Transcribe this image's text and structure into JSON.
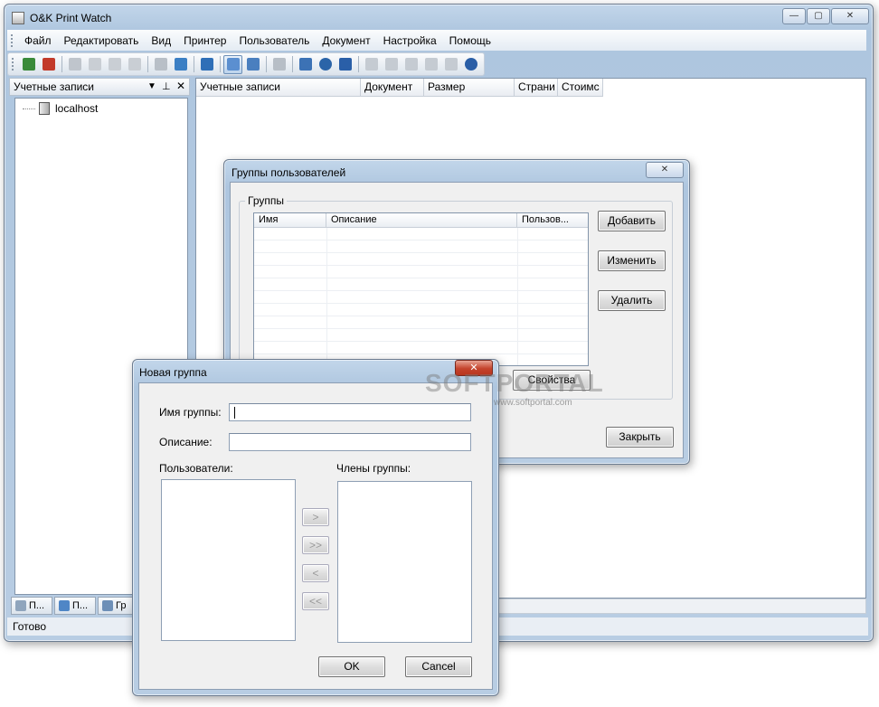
{
  "main_window": {
    "title": "O&K Print Watch",
    "minimize": "—",
    "maximize": "▢",
    "close": "✕"
  },
  "menu": {
    "items": [
      "Файл",
      "Редактировать",
      "Вид",
      "Принтер",
      "Пользователь",
      "Документ",
      "Настройка",
      "Помощь"
    ]
  },
  "left_panel": {
    "title": "Учетные записи",
    "tree": [
      "localhost"
    ],
    "tabs": [
      "П...",
      "П...",
      "Гр"
    ]
  },
  "main_list": {
    "columns": [
      "Учетные записи",
      "Документ",
      "Размер",
      "Страни",
      "Стоимс"
    ]
  },
  "status": "Готово",
  "groups_dialog": {
    "title": "Группы пользователей",
    "groupbox_label": "Группы",
    "columns": [
      "Имя",
      "Описание",
      "Пользов..."
    ],
    "buttons": {
      "add": "Добавить",
      "edit": "Изменить",
      "delete": "Удалить",
      "properties": "Свойства",
      "close": "Закрыть"
    }
  },
  "new_group_dialog": {
    "title": "Новая группа",
    "name_label": "Имя группы:",
    "name_value": "",
    "desc_label": "Описание:",
    "desc_value": "",
    "users_label": "Пользователи:",
    "members_label": "Члены группы:",
    "arrows": [
      ">",
      ">>",
      "<",
      "<<"
    ],
    "ok": "OK",
    "cancel": "Cancel"
  },
  "watermark": {
    "text": "SOFTPORTAL",
    "sub": "www.softportal.com"
  },
  "colors": {
    "accent": "#aec6df",
    "close_red": "#c4432c"
  }
}
